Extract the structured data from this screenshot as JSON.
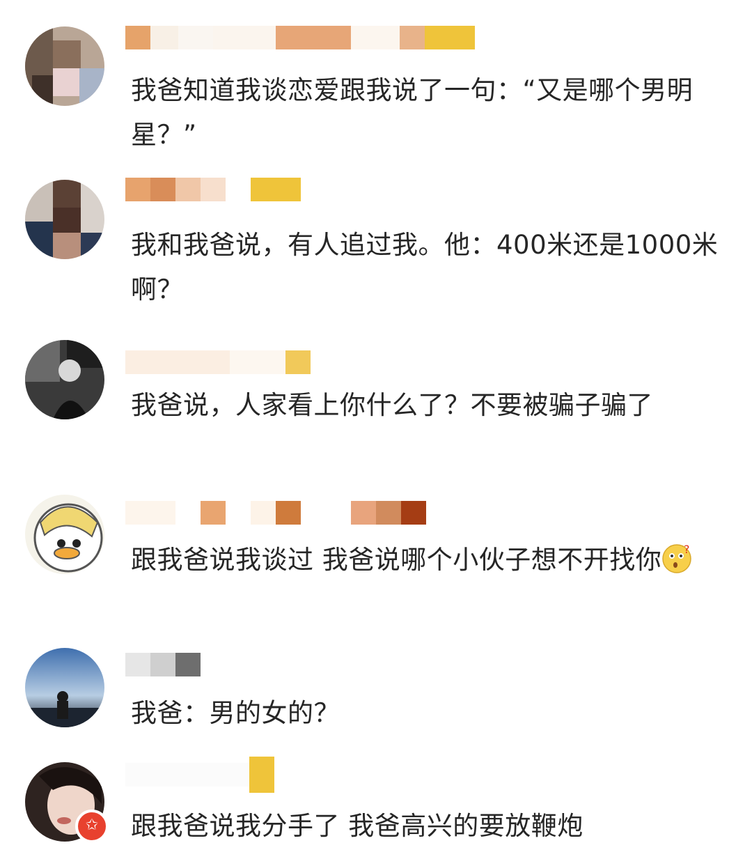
{
  "comments": [
    {
      "text": "我爸知道我谈恋爱跟我说了一句：“又是哪个男明星？”"
    },
    {
      "text": "我和我爸说，有人追过我。他：400米还是1000米啊？"
    },
    {
      "text": "我爸说，人家看上你什么了？不要被骗子骗了"
    },
    {
      "text": "跟我爸说我谈过 我爸说哪个小伙子想不开找你",
      "emoji": "thinking-face-emoji"
    },
    {
      "text": "我爸：男的女的？"
    },
    {
      "text": "跟我爸说我分手了 我爸高兴的要放鞭炮",
      "badge_icon": "verified-badge-icon"
    }
  ],
  "colors": {
    "text": "#262626",
    "background": "#ffffff",
    "badge": "#e8412e",
    "accent_gold": "#efc43a"
  }
}
